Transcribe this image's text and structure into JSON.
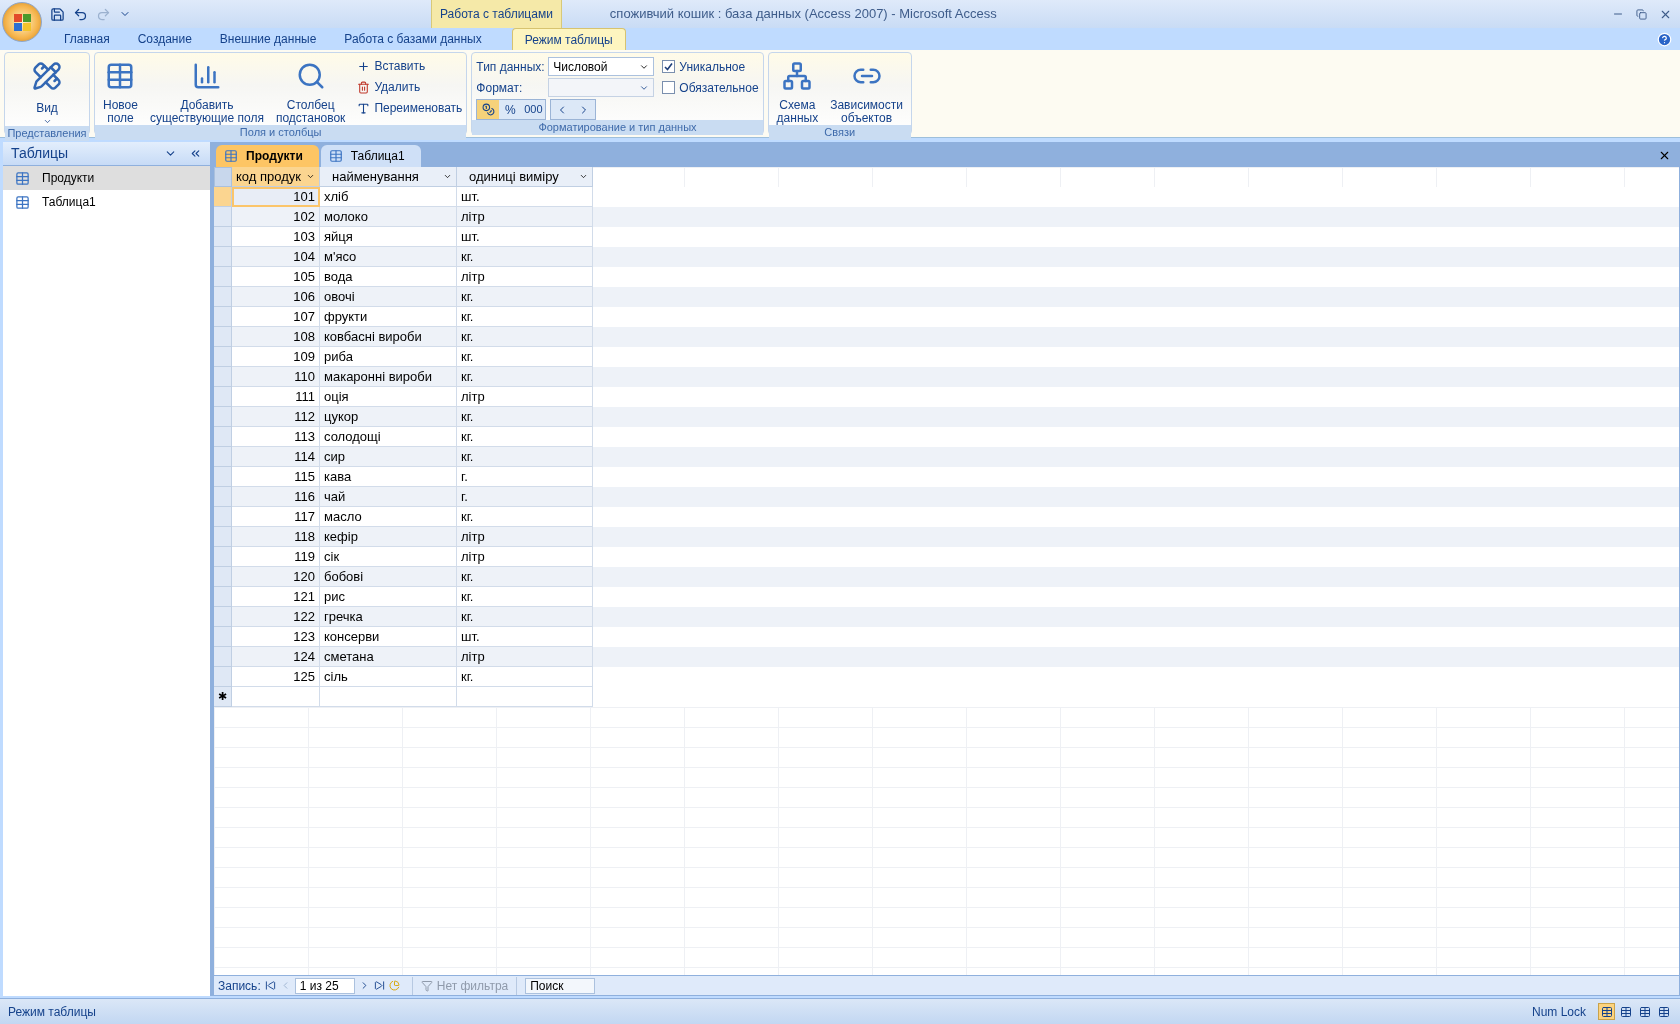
{
  "window": {
    "title": "споживчий кошик : база данных (Access 2007) - Microsoft Access",
    "contextual_group": "Работа с таблицами"
  },
  "ribbon_tabs": [
    {
      "label": "Главная",
      "selected": false
    },
    {
      "label": "Создание",
      "selected": false
    },
    {
      "label": "Внешние данные",
      "selected": false
    },
    {
      "label": "Работа с базами данных",
      "selected": false
    },
    {
      "label": "Режим таблицы",
      "selected": true
    }
  ],
  "ribbon": {
    "views": {
      "title": "Представления",
      "view_button": "Вид"
    },
    "fields": {
      "title": "Поля и столбцы",
      "new_field": [
        "Новое",
        "поле"
      ],
      "add_existing": [
        "Добавить",
        "существующие поля"
      ],
      "lookup_column": [
        "Столбец",
        "подстановок"
      ],
      "insert": "Вставить",
      "delete": "Удалить",
      "rename": "Переименовать"
    },
    "formatting": {
      "title": "Форматирование и тип данных",
      "data_type_label": "Тип данных:",
      "data_type_value": "Числовой",
      "format_label": "Формат:",
      "unique": {
        "label": "Уникальное",
        "checked": true
      },
      "required": {
        "label": "Обязательное",
        "checked": false
      },
      "percent": "%",
      "thousands": "000"
    },
    "relationships": {
      "title": "Связи",
      "schema": [
        "Схема",
        "данных"
      ],
      "dependencies": [
        "Зависимости",
        "объектов"
      ]
    }
  },
  "nav_pane": {
    "title": "Таблицы",
    "items": [
      {
        "label": "Продукти",
        "selected": true
      },
      {
        "label": "Таблица1",
        "selected": false
      }
    ]
  },
  "document_tabs": [
    {
      "label": "Продукти",
      "selected": true
    },
    {
      "label": "Таблица1",
      "selected": false
    }
  ],
  "datasheet": {
    "columns": [
      {
        "label": "код продук",
        "selected": true
      },
      {
        "label": "найменування",
        "selected": false
      },
      {
        "label": "одиниці виміру",
        "selected": false
      }
    ],
    "rows": [
      {
        "cells": [
          "101",
          "хліб",
          "шт."
        ],
        "selected": true
      },
      {
        "cells": [
          "102",
          "молоко",
          "літр"
        ],
        "selected": false
      },
      {
        "cells": [
          "103",
          "яйця",
          "шт."
        ],
        "selected": false
      },
      {
        "cells": [
          "104",
          "м'ясо",
          "кг."
        ],
        "selected": false
      },
      {
        "cells": [
          "105",
          "вода",
          "літр"
        ],
        "selected": false
      },
      {
        "cells": [
          "106",
          "овочі",
          "кг."
        ],
        "selected": false
      },
      {
        "cells": [
          "107",
          "фрукти",
          "кг."
        ],
        "selected": false
      },
      {
        "cells": [
          "108",
          "ковбасні вироби",
          "кг."
        ],
        "selected": false
      },
      {
        "cells": [
          "109",
          "риба",
          "кг."
        ],
        "selected": false
      },
      {
        "cells": [
          "110",
          "макаронні вироби",
          "кг."
        ],
        "selected": false
      },
      {
        "cells": [
          "111",
          "оція",
          "літр"
        ],
        "selected": false
      },
      {
        "cells": [
          "112",
          "цукор",
          "кг."
        ],
        "selected": false
      },
      {
        "cells": [
          "113",
          "солодощі",
          "кг."
        ],
        "selected": false
      },
      {
        "cells": [
          "114",
          "сир",
          "кг."
        ],
        "selected": false
      },
      {
        "cells": [
          "115",
          "кава",
          "г."
        ],
        "selected": false
      },
      {
        "cells": [
          "116",
          "чай",
          "г."
        ],
        "selected": false
      },
      {
        "cells": [
          "117",
          "масло",
          "кг."
        ],
        "selected": false
      },
      {
        "cells": [
          "118",
          "кефір",
          "літр"
        ],
        "selected": false
      },
      {
        "cells": [
          "119",
          "сік",
          "літр"
        ],
        "selected": false
      },
      {
        "cells": [
          "120",
          "бобові",
          "кг."
        ],
        "selected": false
      },
      {
        "cells": [
          "121",
          "рис",
          "кг."
        ],
        "selected": false
      },
      {
        "cells": [
          "122",
          "гречка",
          "кг."
        ],
        "selected": false
      },
      {
        "cells": [
          "123",
          "консерви",
          "шт."
        ],
        "selected": false
      },
      {
        "cells": [
          "124",
          "сметана",
          "літр"
        ],
        "selected": false
      },
      {
        "cells": [
          "125",
          "сіль",
          "кг."
        ],
        "selected": false
      }
    ],
    "new_row_marker": "✱"
  },
  "record_nav": {
    "label": "Запись:",
    "position": "1 из 25",
    "filter": {
      "label": "Нет фильтра",
      "disabled": true
    },
    "search": {
      "placeholder": "Поиск"
    }
  },
  "status_bar": {
    "mode": "Режим таблицы",
    "num_lock": "Num Lock",
    "views": [
      {
        "selected": true
      },
      {
        "selected": false
      },
      {
        "selected": false
      },
      {
        "selected": false
      }
    ]
  }
}
